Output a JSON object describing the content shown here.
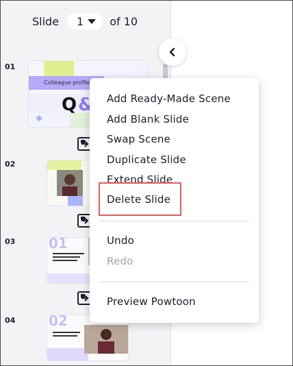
{
  "slide_nav": {
    "prefix": "Slide",
    "current": "1",
    "suffix": "of 10"
  },
  "slides": [
    {
      "number": "01",
      "title_text": "Colleague profile u",
      "big_text": "Q&A"
    },
    {
      "number": "02"
    },
    {
      "number": "03",
      "big_text": "01"
    },
    {
      "number": "04",
      "big_text": "02"
    }
  ],
  "context_menu": {
    "items": [
      {
        "label": "Add Ready-Made Scene",
        "disabled": false
      },
      {
        "label": "Add Blank Slide",
        "disabled": false
      },
      {
        "label": "Swap Scene",
        "disabled": false
      },
      {
        "label": "Duplicate Slide",
        "disabled": false
      },
      {
        "label": "Extend Slide",
        "disabled": false
      },
      {
        "label": "Delete Slide",
        "disabled": false
      },
      {
        "label": "Undo",
        "disabled": false
      },
      {
        "label": "Redo",
        "disabled": true
      },
      {
        "label": "Preview Powtoon",
        "disabled": false
      }
    ]
  },
  "colors": {
    "highlight": "#e25c5c",
    "panel_bg": "#f3f3f6",
    "accent_purple": "#8b7cf6",
    "accent_lime": "#d9f07a"
  },
  "icons": {
    "collapse": "chevron-left-icon",
    "transition": "transition-icon",
    "dropdown": "caret-down-icon"
  }
}
